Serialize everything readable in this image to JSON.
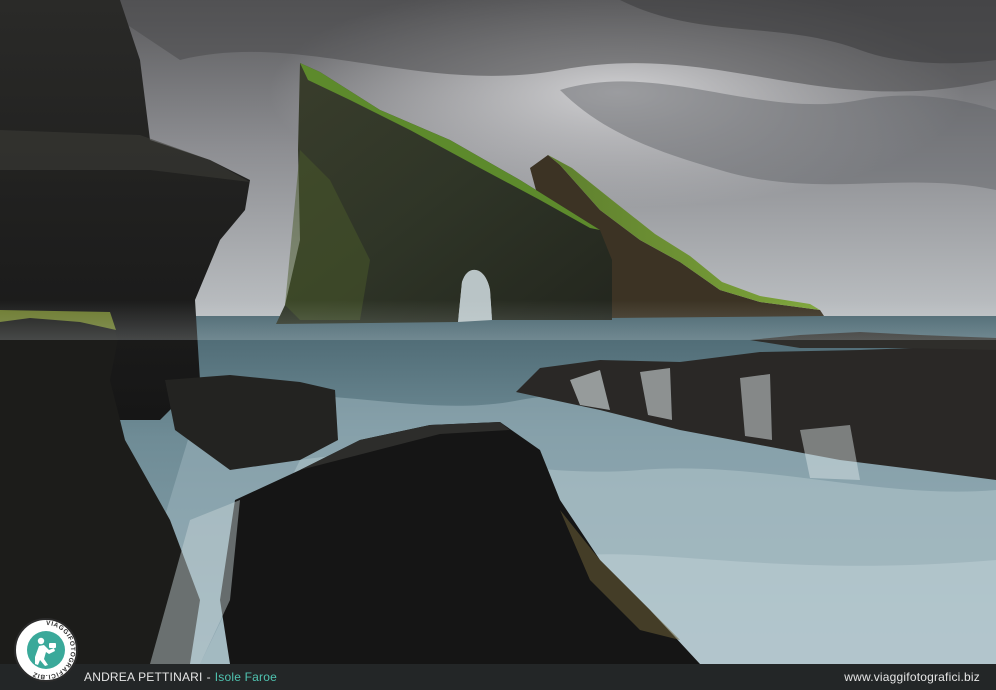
{
  "footer": {
    "author": "ANDREA PETTINARI",
    "separator": "-",
    "location": "Isole Faroe",
    "website": "www.viaggifotografici.biz"
  },
  "logo": {
    "text": "VIAGGIFOTOGRAFICI.BIZ",
    "icon": "photographer-icon"
  },
  "colors": {
    "accent": "#4fc3b0",
    "footer_bg": "#232627",
    "footer_text": "#e6e6e6"
  }
}
